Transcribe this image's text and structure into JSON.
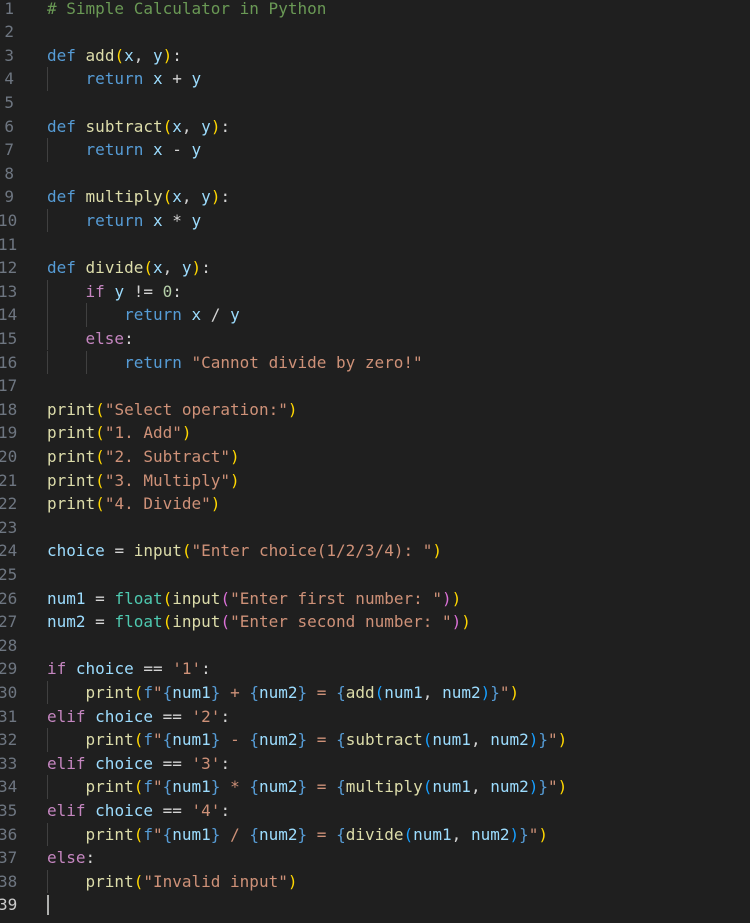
{
  "editor": {
    "language": "python",
    "theme_colors": {
      "background": "#1f1f1f",
      "keyword": "#569cd6",
      "control": "#c586c0",
      "function": "#dcdcaa",
      "variable": "#9cdcfe",
      "string": "#ce9178",
      "number": "#b5cea8",
      "comment": "#6a9955",
      "bracket_1": "#ffd700",
      "bracket_2": "#da70d6",
      "bracket_3": "#179fff",
      "line_number": "#6e7681"
    },
    "cursor_line": 39,
    "lines": [
      {
        "n": "1",
        "text": "# Simple Calculator in Python"
      },
      {
        "n": "2",
        "text": ""
      },
      {
        "n": "3",
        "text": "def add(x, y):"
      },
      {
        "n": "4",
        "text": "    return x + y"
      },
      {
        "n": "5",
        "text": ""
      },
      {
        "n": "6",
        "text": "def subtract(x, y):"
      },
      {
        "n": "7",
        "text": "    return x - y"
      },
      {
        "n": "8",
        "text": ""
      },
      {
        "n": "9",
        "text": "def multiply(x, y):"
      },
      {
        "n": "10",
        "text": "    return x * y"
      },
      {
        "n": "11",
        "text": ""
      },
      {
        "n": "12",
        "text": "def divide(x, y):"
      },
      {
        "n": "13",
        "text": "    if y != 0:"
      },
      {
        "n": "14",
        "text": "        return x / y"
      },
      {
        "n": "15",
        "text": "    else:"
      },
      {
        "n": "16",
        "text": "        return \"Cannot divide by zero!\""
      },
      {
        "n": "17",
        "text": ""
      },
      {
        "n": "18",
        "text": "print(\"Select operation:\")"
      },
      {
        "n": "19",
        "text": "print(\"1. Add\")"
      },
      {
        "n": "20",
        "text": "print(\"2. Subtract\")"
      },
      {
        "n": "21",
        "text": "print(\"3. Multiply\")"
      },
      {
        "n": "22",
        "text": "print(\"4. Divide\")"
      },
      {
        "n": "23",
        "text": ""
      },
      {
        "n": "24",
        "text": "choice = input(\"Enter choice(1/2/3/4): \")"
      },
      {
        "n": "25",
        "text": ""
      },
      {
        "n": "26",
        "text": "num1 = float(input(\"Enter first number: \"))"
      },
      {
        "n": "27",
        "text": "num2 = float(input(\"Enter second number: \"))"
      },
      {
        "n": "28",
        "text": ""
      },
      {
        "n": "29",
        "text": "if choice == '1':"
      },
      {
        "n": "30",
        "text": "    print(f\"{num1} + {num2} = {add(num1, num2)}\")"
      },
      {
        "n": "31",
        "text": "elif choice == '2':"
      },
      {
        "n": "32",
        "text": "    print(f\"{num1} - {num2} = {subtract(num1, num2)}\")"
      },
      {
        "n": "33",
        "text": "elif choice == '3':"
      },
      {
        "n": "34",
        "text": "    print(f\"{num1} * {num2} = {multiply(num1, num2)}\")"
      },
      {
        "n": "35",
        "text": "elif choice == '4':"
      },
      {
        "n": "36",
        "text": "    print(f\"{num1} / {num2} = {divide(num1, num2)}\")"
      },
      {
        "n": "37",
        "text": "else:"
      },
      {
        "n": "38",
        "text": "    print(\"Invalid input\")"
      },
      {
        "n": "39",
        "text": ""
      }
    ]
  }
}
